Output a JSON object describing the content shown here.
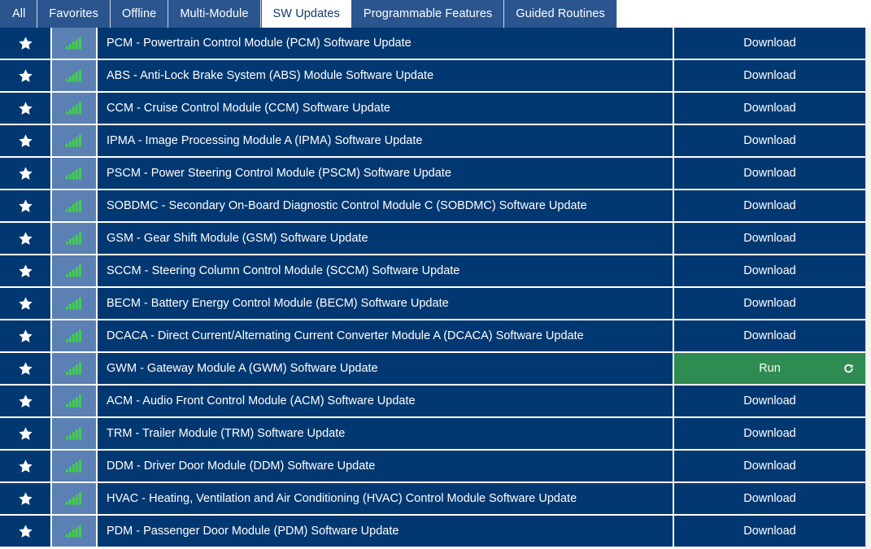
{
  "tabs": [
    {
      "label": "All",
      "active": false
    },
    {
      "label": "Favorites",
      "active": false
    },
    {
      "label": "Offline",
      "active": false
    },
    {
      "label": "Multi-Module",
      "active": false
    },
    {
      "label": "SW Updates",
      "active": true
    },
    {
      "label": "Programmable Features",
      "active": false
    },
    {
      "label": "Guided Routines",
      "active": false
    }
  ],
  "colors": {
    "row_background": "#023871",
    "signal_cell_background": "#5a80b4",
    "signal_bars": "#3cd63c",
    "tab_background": "#2b558e",
    "tab_active_background": "#ffffff",
    "tab_active_text": "#163a6b",
    "run_button": "#2e8b51",
    "text": "#ffffff"
  },
  "icons": {
    "favorite": "star-icon",
    "signal": "signal-bars-icon",
    "refresh": "refresh-icon"
  },
  "actions": {
    "download": "Download",
    "run": "Run"
  },
  "rows": [
    {
      "label": "PCM - Powertrain Control Module (PCM) Software Update",
      "action": "Download",
      "state": "download"
    },
    {
      "label": "ABS - Anti-Lock Brake System (ABS) Module Software Update",
      "action": "Download",
      "state": "download"
    },
    {
      "label": "CCM - Cruise Control Module (CCM) Software Update",
      "action": "Download",
      "state": "download"
    },
    {
      "label": "IPMA - Image Processing Module A (IPMA) Software Update",
      "action": "Download",
      "state": "download"
    },
    {
      "label": "PSCM - Power Steering Control Module (PSCM) Software Update",
      "action": "Download",
      "state": "download"
    },
    {
      "label": "SOBDMC - Secondary On-Board Diagnostic Control Module C (SOBDMC) Software Update",
      "action": "Download",
      "state": "download"
    },
    {
      "label": "GSM - Gear Shift Module (GSM) Software Update",
      "action": "Download",
      "state": "download"
    },
    {
      "label": "SCCM - Steering Column Control Module (SCCM) Software Update",
      "action": "Download",
      "state": "download"
    },
    {
      "label": "BECM - Battery Energy Control Module (BECM) Software Update",
      "action": "Download",
      "state": "download"
    },
    {
      "label": "DCACA - Direct Current/Alternating Current Converter Module A (DCACA) Software Update",
      "action": "Download",
      "state": "download"
    },
    {
      "label": "GWM - Gateway Module A (GWM) Software Update",
      "action": "Run",
      "state": "run"
    },
    {
      "label": "ACM - Audio Front Control Module (ACM) Software Update",
      "action": "Download",
      "state": "download"
    },
    {
      "label": "TRM - Trailer Module (TRM) Software Update",
      "action": "Download",
      "state": "download"
    },
    {
      "label": "DDM - Driver Door Module (DDM) Software Update",
      "action": "Download",
      "state": "download"
    },
    {
      "label": "HVAC - Heating, Ventilation and Air Conditioning (HVAC) Control Module Software Update",
      "action": "Download",
      "state": "download"
    },
    {
      "label": "PDM - Passenger Door Module (PDM) Software Update",
      "action": "Download",
      "state": "download"
    }
  ]
}
